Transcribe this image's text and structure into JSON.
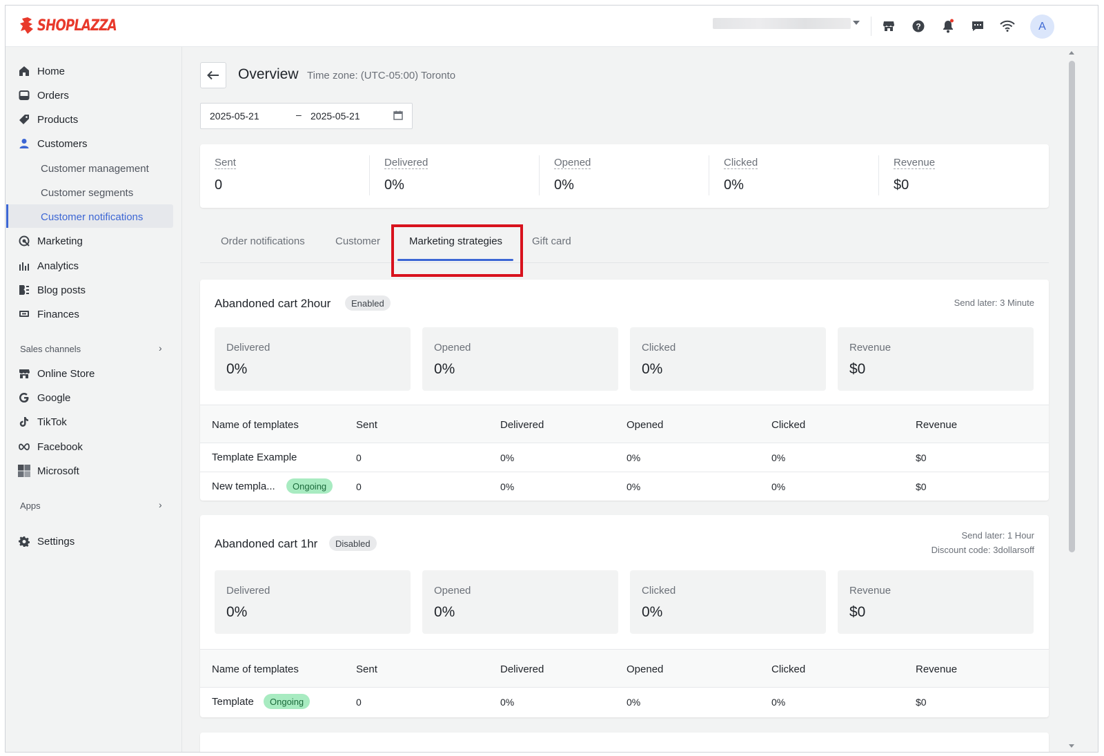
{
  "brand": {
    "name": "SHOPLAZZA",
    "color": "#e8392b",
    "accent": "#3c66d4",
    "highlight": "#d8121d"
  },
  "topbar": {
    "icons": [
      "store-icon",
      "help-icon",
      "bell-icon",
      "chat-icon",
      "wifi-icon"
    ],
    "avatar_initial": "A"
  },
  "sidebar": {
    "items": [
      {
        "label": "Home",
        "icon": "home-icon"
      },
      {
        "label": "Orders",
        "icon": "orders-icon"
      },
      {
        "label": "Products",
        "icon": "tag-icon"
      },
      {
        "label": "Customers",
        "icon": "person-icon"
      }
    ],
    "customer_subitems": [
      {
        "label": "Customer management"
      },
      {
        "label": "Customer segments"
      },
      {
        "label": "Customer notifications"
      }
    ],
    "items2": [
      {
        "label": "Marketing",
        "icon": "marketing-icon"
      },
      {
        "label": "Analytics",
        "icon": "analytics-icon"
      },
      {
        "label": "Blog posts",
        "icon": "blog-icon"
      },
      {
        "label": "Finances",
        "icon": "finances-icon"
      }
    ],
    "sales_channels_label": "Sales channels",
    "channels": [
      {
        "label": "Online Store",
        "icon": "store-icon"
      },
      {
        "label": "Google",
        "icon": "google-icon"
      },
      {
        "label": "TikTok",
        "icon": "tiktok-icon"
      },
      {
        "label": "Facebook",
        "icon": "meta-icon"
      },
      {
        "label": "Microsoft",
        "icon": "microsoft-icon"
      }
    ],
    "apps_label": "Apps",
    "settings_label": "Settings"
  },
  "header": {
    "title": "Overview",
    "timezone": "Time zone: (UTC-05:00) Toronto",
    "date_start": "2025-05-21",
    "date_sep": "–",
    "date_end": "2025-05-21"
  },
  "summary": [
    {
      "label": "Sent",
      "value": "0"
    },
    {
      "label": "Delivered",
      "value": "0%"
    },
    {
      "label": "Opened",
      "value": "0%"
    },
    {
      "label": "Clicked",
      "value": "0%"
    },
    {
      "label": "Revenue",
      "value": "$0"
    }
  ],
  "tabs": [
    {
      "label": "Order notifications"
    },
    {
      "label": "Customer"
    },
    {
      "label": "Marketing strategies",
      "active": true
    },
    {
      "label": "Gift card"
    }
  ],
  "table_headers": [
    "Name of templates",
    "Sent",
    "Delivered",
    "Opened",
    "Clicked",
    "Revenue"
  ],
  "strategies": [
    {
      "title": "Abandoned cart 2hour",
      "status": "Enabled",
      "meta": [
        "Send later: 3 Minute"
      ],
      "stats": [
        {
          "label": "Delivered",
          "value": "0%"
        },
        {
          "label": "Opened",
          "value": "0%"
        },
        {
          "label": "Clicked",
          "value": "0%"
        },
        {
          "label": "Revenue",
          "value": "$0"
        }
      ],
      "rows": [
        {
          "name": "Template Example",
          "badge": "",
          "sent": "0",
          "delivered": "0%",
          "opened": "0%",
          "clicked": "0%",
          "revenue": "$0"
        },
        {
          "name": "New templa...",
          "badge": "Ongoing",
          "sent": "0",
          "delivered": "0%",
          "opened": "0%",
          "clicked": "0%",
          "revenue": "$0"
        }
      ]
    },
    {
      "title": "Abandoned cart 1hr",
      "status": "Disabled",
      "meta": [
        "Send later: 1 Hour",
        "Discount code: 3dollarsoff"
      ],
      "stats": [
        {
          "label": "Delivered",
          "value": "0%"
        },
        {
          "label": "Opened",
          "value": "0%"
        },
        {
          "label": "Clicked",
          "value": "0%"
        },
        {
          "label": "Revenue",
          "value": "$0"
        }
      ],
      "rows": [
        {
          "name": "Template",
          "badge": "Ongoing",
          "sent": "0",
          "delivered": "0%",
          "opened": "0%",
          "clicked": "0%",
          "revenue": "$0"
        }
      ]
    }
  ]
}
